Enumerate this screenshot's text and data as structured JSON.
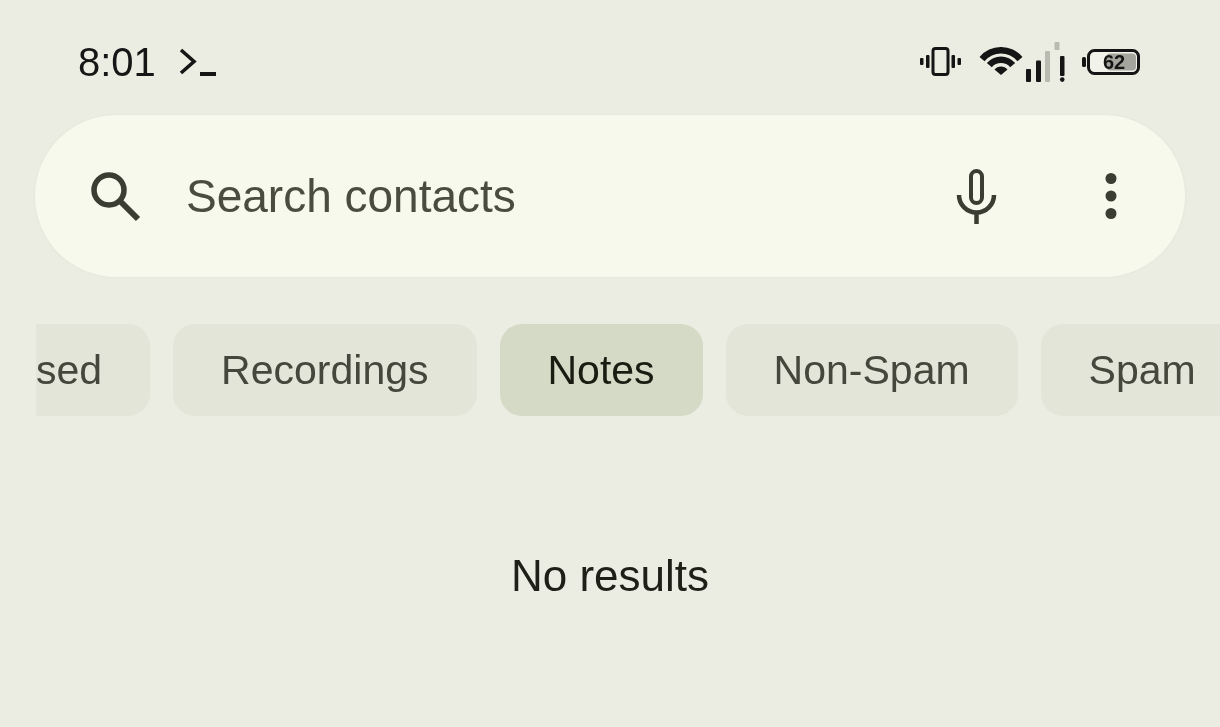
{
  "status_bar": {
    "time": "8:01",
    "battery": "62"
  },
  "search": {
    "placeholder": "Search contacts"
  },
  "filter_chips": [
    {
      "label": "sed",
      "selected": false
    },
    {
      "label": "Recordings",
      "selected": false
    },
    {
      "label": "Notes",
      "selected": true
    },
    {
      "label": "Non-Spam",
      "selected": false
    },
    {
      "label": "Spam",
      "selected": false
    }
  ],
  "empty_state": {
    "message": "No results"
  }
}
